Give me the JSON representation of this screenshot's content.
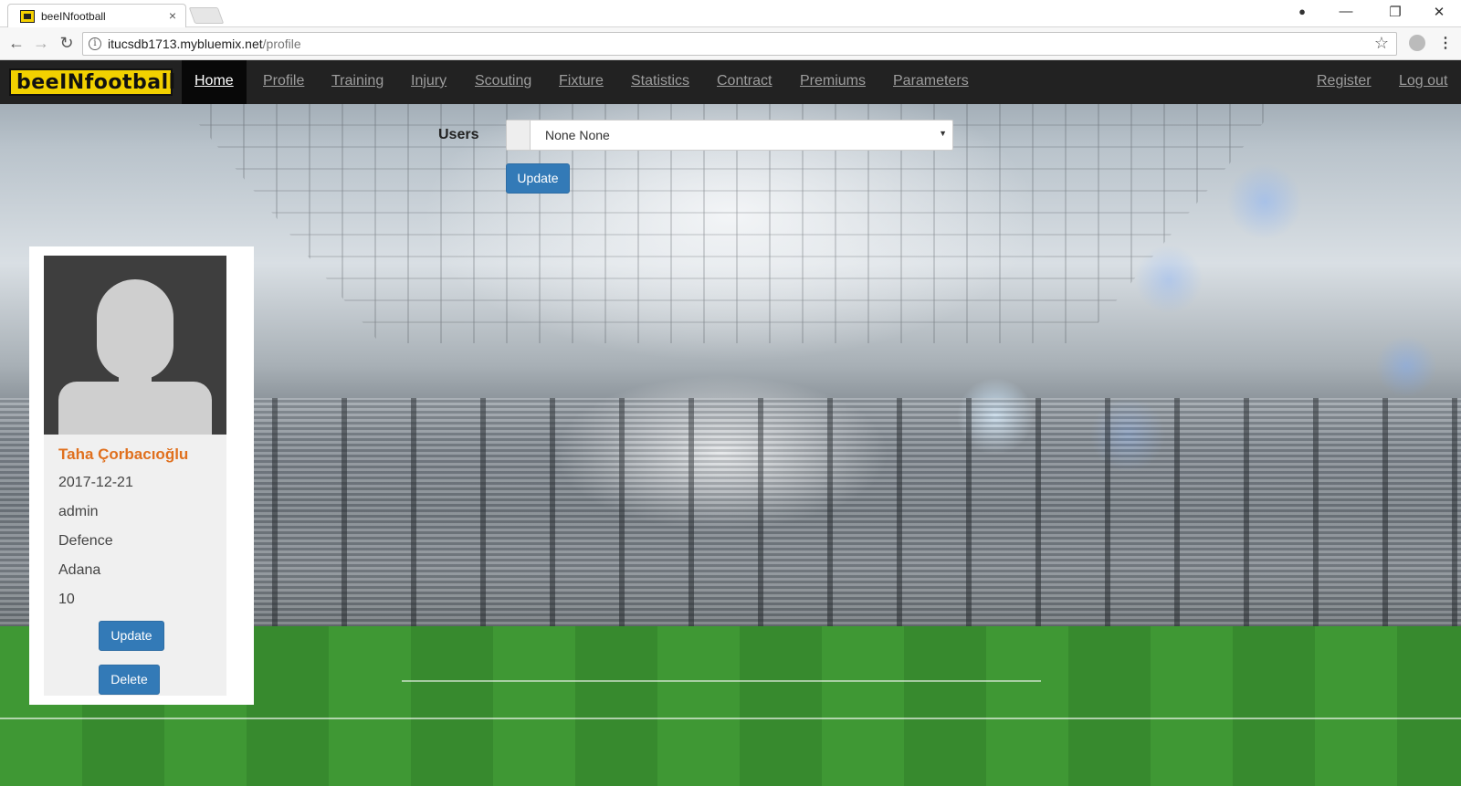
{
  "browser": {
    "tab_title": "beeINfootball",
    "tab_close": "×",
    "url_host": "itucsdb1713.mybluemix.net",
    "url_path": "/profile",
    "back_icon": "←",
    "forward_icon": "→",
    "reload_icon": "↻",
    "star_icon": "☆",
    "info_icon": "i",
    "menu_icon": "⋮",
    "minimize_icon": "—",
    "restore_icon": "❐",
    "close_icon": "✕",
    "profile_icon": "●"
  },
  "site": {
    "logo": "beeINfootball",
    "nav": [
      "Home",
      "Profile",
      "Training",
      "Injury",
      "Scouting",
      "Fixture",
      "Statistics",
      "Contract",
      "Premiums",
      "Parameters"
    ],
    "nav_right": [
      "Register",
      "Log out"
    ]
  },
  "users_form": {
    "label": "Users",
    "selected": "None None",
    "arrow": "▼",
    "update_label": "Update"
  },
  "profile": {
    "name": "Taha Çorbacıoğlu",
    "date": "2017-12-21",
    "role": "admin",
    "position": "Defence",
    "city": "Adana",
    "number": "10",
    "update_label": "Update",
    "delete_label": "Delete"
  },
  "colors": {
    "navbar": "#222222",
    "logo_yellow": "#f2d100",
    "button_blue": "#337ab7",
    "name_orange": "#e0701e"
  }
}
